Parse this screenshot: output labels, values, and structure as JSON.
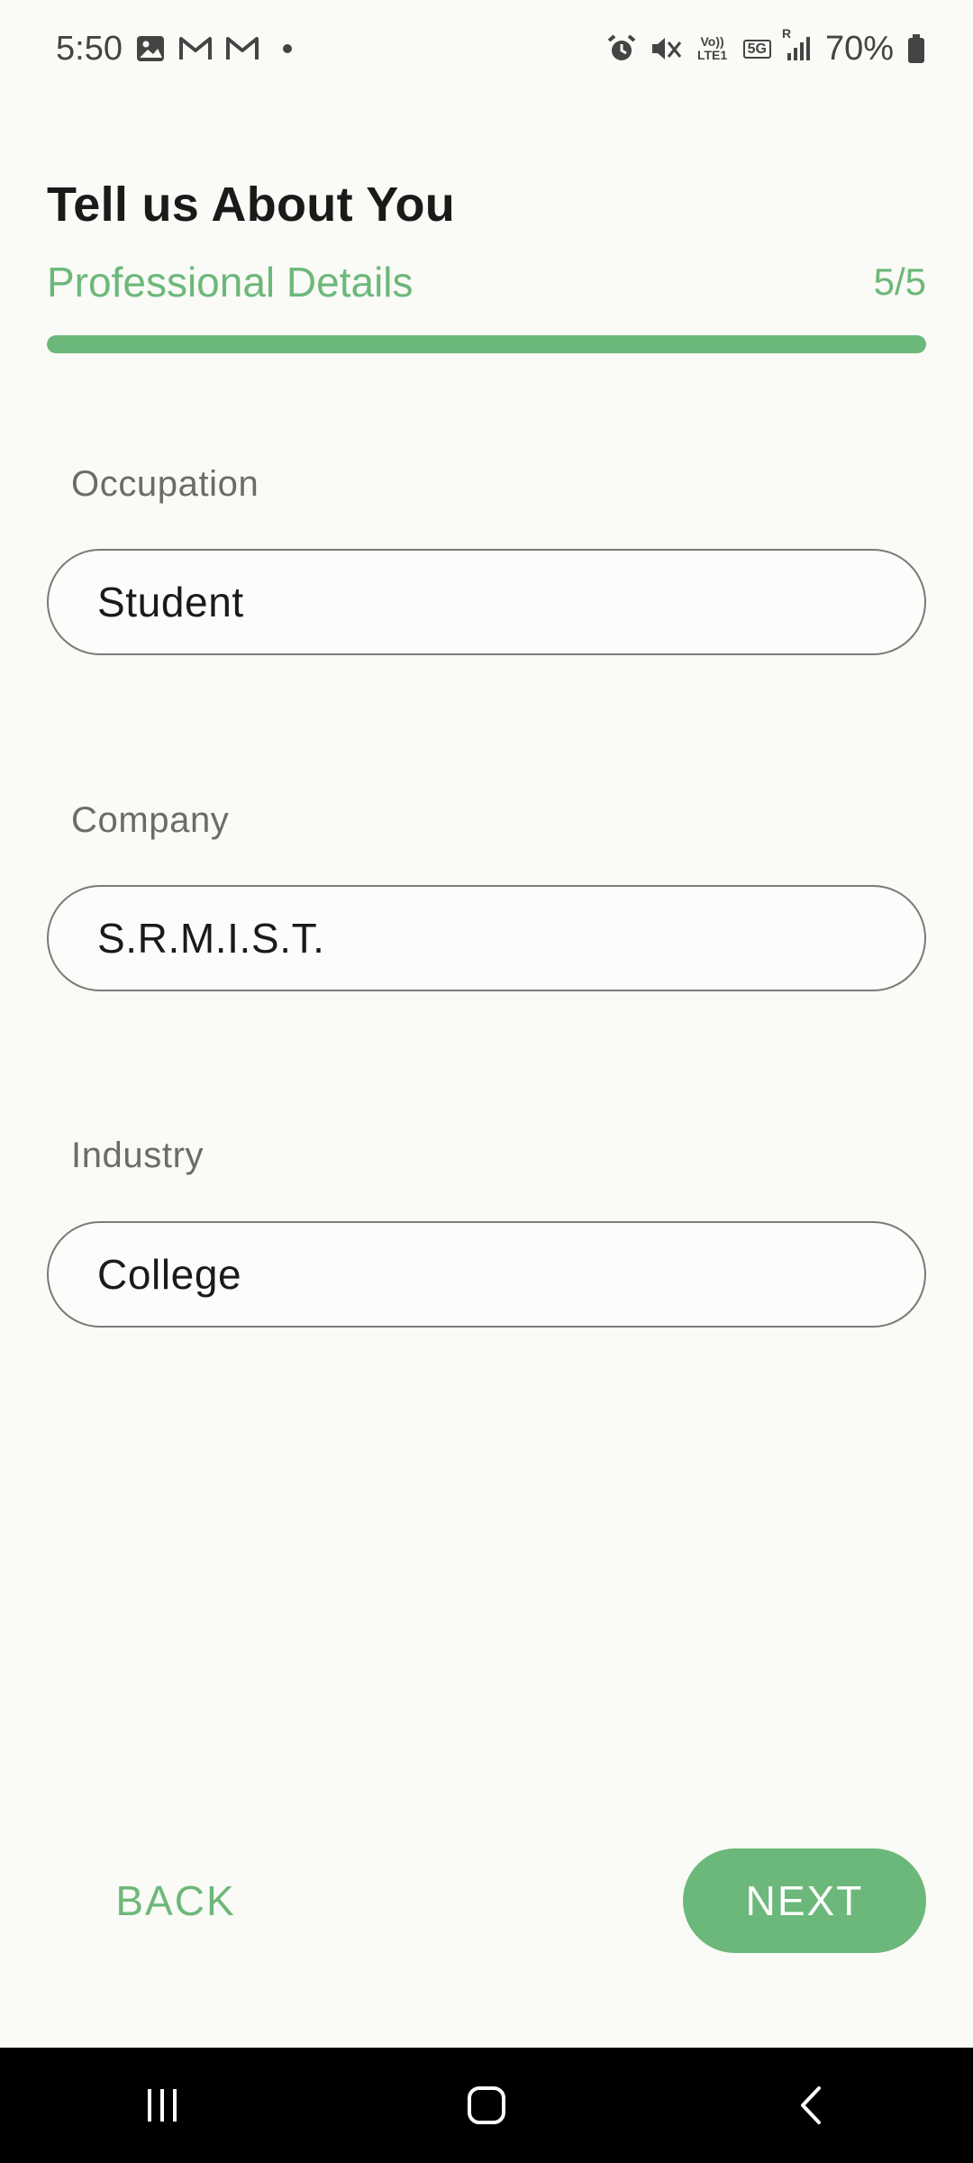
{
  "status_bar": {
    "time": "5:50",
    "left_icons": [
      "image-icon",
      "gmail-icon",
      "gmail-icon",
      "dot-icon"
    ],
    "right_icons": [
      "alarm-icon",
      "mute-icon",
      "volte-icon",
      "5g-icon",
      "signal-icon",
      "battery-icon"
    ],
    "volte_text": "Vo)) LTE1",
    "network_text": "5G",
    "roaming_text": "R",
    "battery_percent": "70%"
  },
  "header": {
    "title": "Tell us About You",
    "subtitle": "Professional Details",
    "step": "5/5",
    "progress": 1.0,
    "accent_color": "#6cb87a"
  },
  "form": {
    "occupation": {
      "label": "Occupation",
      "value": "Student"
    },
    "company": {
      "label": "Company",
      "value": "S.R.M.I.S.T."
    },
    "industry": {
      "label": "Industry",
      "value": "College"
    }
  },
  "actions": {
    "back_label": "BACK",
    "next_label": "NEXT"
  },
  "nav_bar": {
    "buttons": [
      "recents-icon",
      "home-icon",
      "back-icon"
    ]
  }
}
